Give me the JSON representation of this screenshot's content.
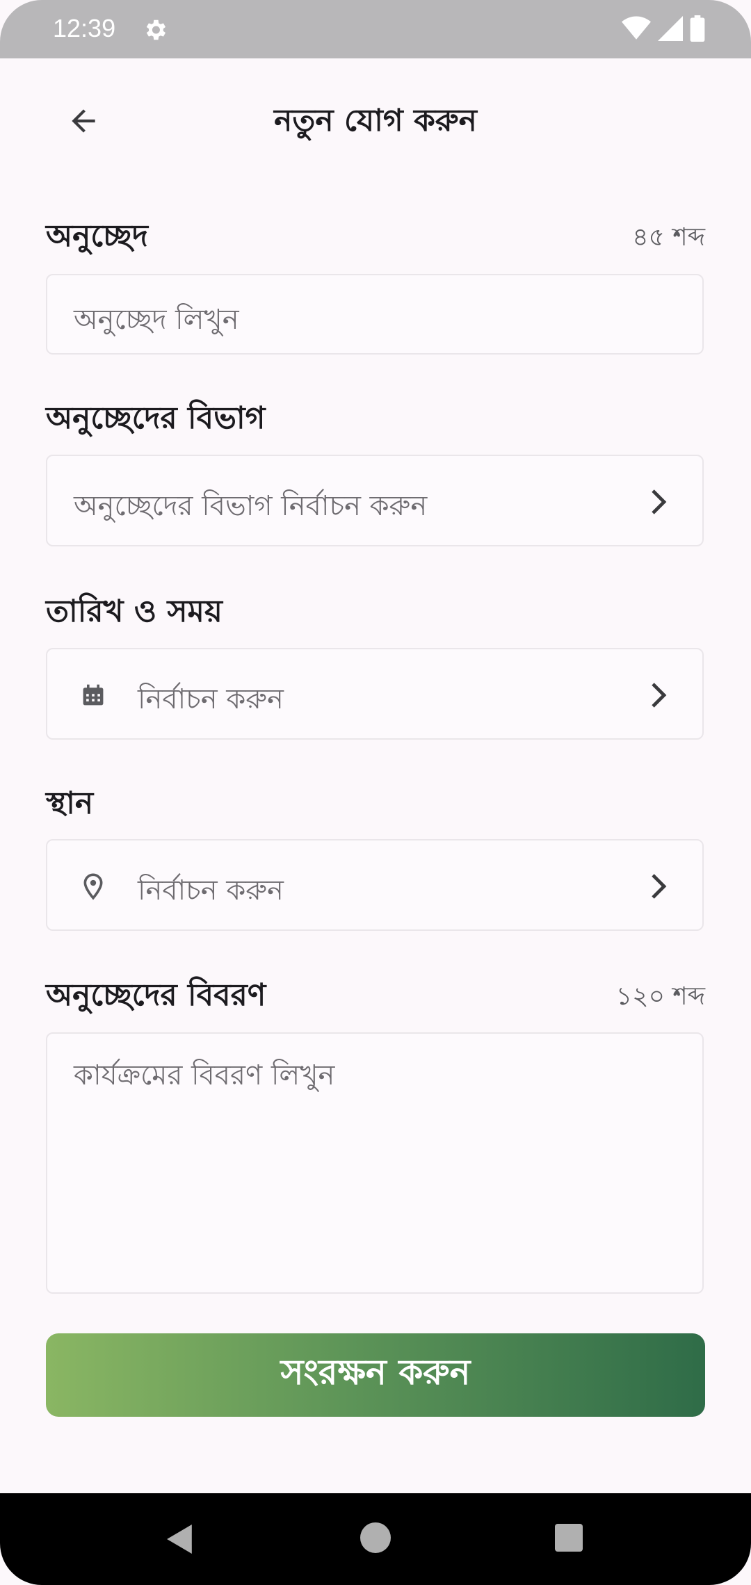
{
  "status_bar": {
    "time": "12:39"
  },
  "header": {
    "title": "নতুন যোগ করুন"
  },
  "paragraph": {
    "label": "অনুচ্ছেদ",
    "word_count": "৪৫ শব্দ",
    "placeholder": "অনুচ্ছেদ লিখুন"
  },
  "category": {
    "label": "অনুচ্ছেদের বিভাগ",
    "placeholder": "অনুচ্ছেদের বিভাগ নির্বাচন করুন"
  },
  "datetime": {
    "label": "তারিখ ও সময়",
    "placeholder": "নির্বাচন করুন"
  },
  "location": {
    "label": "স্থান",
    "placeholder": "নির্বাচন করুন"
  },
  "description": {
    "label": "অনুচ্ছেদের বিবরণ",
    "word_count": "১২০ শব্দ",
    "placeholder": "কার্যক্রমের বিবরণ লিখুন"
  },
  "save_button": {
    "label": "সংরক্ষন করুন"
  },
  "icons": [
    "gear-icon",
    "wifi-icon",
    "signal-icon",
    "battery-icon",
    "back-arrow-icon",
    "chevron-right-icon",
    "calendar-icon",
    "location-pin-icon",
    "nav-back-icon",
    "nav-home-icon",
    "nav-recents-icon"
  ],
  "colors": {
    "button_gradient_start": "#8ab663",
    "button_gradient_end": "#2f6c48",
    "background": "#fcf8fb"
  }
}
